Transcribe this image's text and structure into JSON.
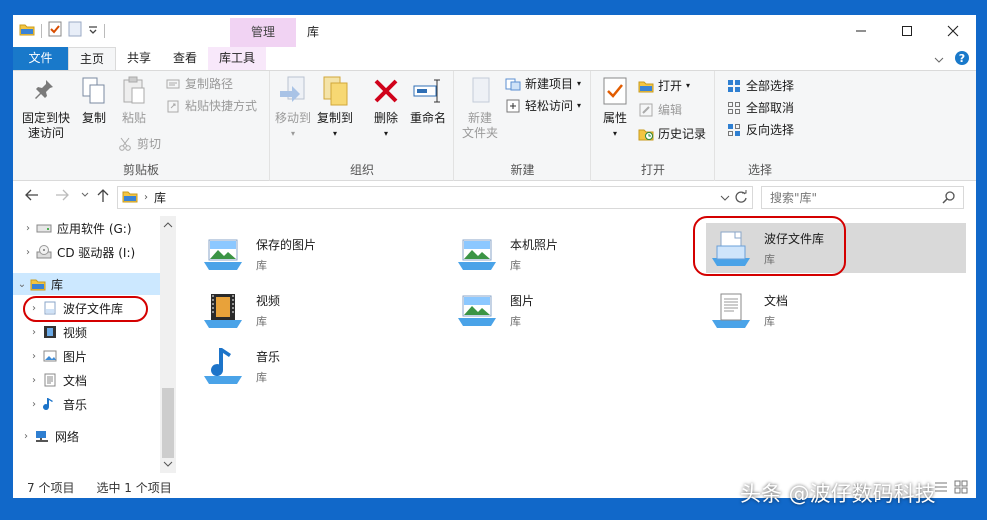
{
  "window": {
    "title": "库",
    "context_tab_header": "管理",
    "controls": {
      "minimize": "minimize-icon",
      "maximize": "maximize-icon",
      "close": "close-icon"
    }
  },
  "tabs": [
    {
      "label": "文件"
    },
    {
      "label": "主页"
    },
    {
      "label": "共享"
    },
    {
      "label": "查看"
    },
    {
      "label": "库工具"
    }
  ],
  "ribbon": {
    "clipboard": {
      "group_label": "剪贴板",
      "pin_line1": "固定到快",
      "pin_line2": "速访问",
      "copy": "复制",
      "paste": "粘贴",
      "copy_path": "复制路径",
      "paste_shortcut": "粘贴快捷方式",
      "cut": "剪切"
    },
    "organize": {
      "group_label": "组织",
      "move_to": "移动到",
      "copy_to": "复制到",
      "delete": "删除",
      "rename": "重命名"
    },
    "new": {
      "group_label": "新建",
      "new_folder_line1": "新建",
      "new_folder_line2": "文件夹",
      "new_item": "新建项目",
      "easy_access": "轻松访问"
    },
    "open": {
      "group_label": "打开",
      "properties": "属性",
      "open": "打开",
      "edit": "编辑",
      "history": "历史记录"
    },
    "select": {
      "group_label": "选择",
      "select_all": "全部选择",
      "select_none": "全部取消",
      "invert": "反向选择"
    }
  },
  "address": {
    "path": "库",
    "search_placeholder": "搜索\"库\""
  },
  "nav": {
    "items": [
      {
        "label": "应用软件 (G:)",
        "icon": "drive-icon"
      },
      {
        "label": "CD 驱动器 (I:)",
        "icon": "cd-drive-icon"
      },
      {
        "label": "库",
        "icon": "library-icon"
      },
      {
        "label": "波仔文件库",
        "icon": "library-doc-icon"
      },
      {
        "label": "视频",
        "icon": "video-library-icon"
      },
      {
        "label": "图片",
        "icon": "pictures-library-icon"
      },
      {
        "label": "文档",
        "icon": "documents-library-icon"
      },
      {
        "label": "音乐",
        "icon": "music-library-icon"
      },
      {
        "label": "网络",
        "icon": "network-icon"
      }
    ]
  },
  "content": {
    "tiles": [
      {
        "name": "保存的图片",
        "sub": "库",
        "icon": "saved-pictures-icon"
      },
      {
        "name": "本机照片",
        "sub": "库",
        "icon": "camera-roll-icon"
      },
      {
        "name": "波仔文件库",
        "sub": "库",
        "icon": "custom-library-icon"
      },
      {
        "name": "视频",
        "sub": "库",
        "icon": "video-library-icon"
      },
      {
        "name": "图片",
        "sub": "库",
        "icon": "pictures-library-icon"
      },
      {
        "name": "文档",
        "sub": "库",
        "icon": "documents-library-icon"
      },
      {
        "name": "音乐",
        "sub": "库",
        "icon": "music-library-icon"
      }
    ]
  },
  "status": {
    "item_count": "7 个项目",
    "selected": "选中 1 个项目"
  },
  "watermark": "头条 @波仔数码科技",
  "colors": {
    "accent": "#1979ca",
    "annotation": "#d40000",
    "context_tab": "#f1d3f3"
  }
}
